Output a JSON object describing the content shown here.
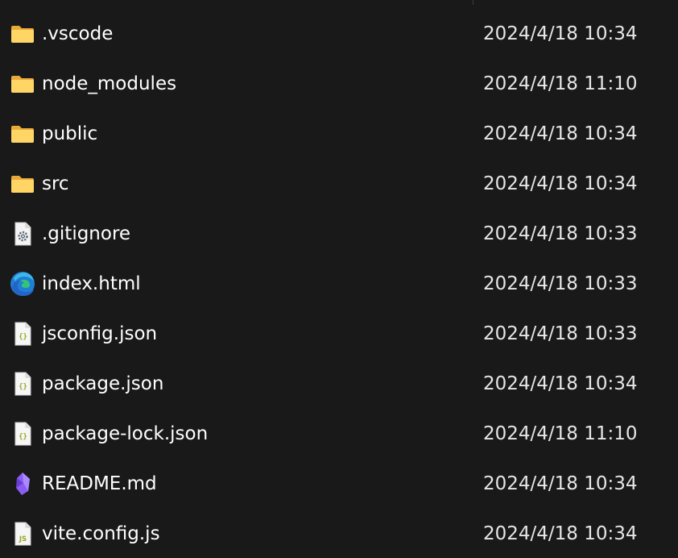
{
  "files": [
    {
      "name": ".vscode",
      "date": "2024/4/18 10:34",
      "type": "folder",
      "icon": "folder-icon"
    },
    {
      "name": "node_modules",
      "date": "2024/4/18 11:10",
      "type": "folder",
      "icon": "folder-icon"
    },
    {
      "name": "public",
      "date": "2024/4/18 10:34",
      "type": "folder",
      "icon": "folder-icon"
    },
    {
      "name": "src",
      "date": "2024/4/18 10:34",
      "type": "folder",
      "icon": "folder-icon"
    },
    {
      "name": ".gitignore",
      "date": "2024/4/18 10:33",
      "type": "settings",
      "icon": "settings-file-icon"
    },
    {
      "name": "index.html",
      "date": "2024/4/18 10:33",
      "type": "edge",
      "icon": "edge-browser-icon"
    },
    {
      "name": "jsconfig.json",
      "date": "2024/4/18 10:33",
      "type": "json",
      "icon": "json-file-icon"
    },
    {
      "name": "package.json",
      "date": "2024/4/18 10:34",
      "type": "json",
      "icon": "json-file-icon"
    },
    {
      "name": "package-lock.json",
      "date": "2024/4/18 11:10",
      "type": "json",
      "icon": "json-file-icon"
    },
    {
      "name": "README.md",
      "date": "2024/4/18 10:34",
      "type": "md",
      "icon": "obsidian-md-icon"
    },
    {
      "name": "vite.config.js",
      "date": "2024/4/18 10:34",
      "type": "js",
      "icon": "js-file-icon"
    }
  ],
  "colors": {
    "background": "#191919",
    "text": "#ffffff",
    "folder": "#f5c242",
    "json_accent": "#9aa520",
    "md_accent": "#8a5cf5",
    "edge_blue": "#1f7fd6",
    "edge_green": "#37c27a"
  }
}
